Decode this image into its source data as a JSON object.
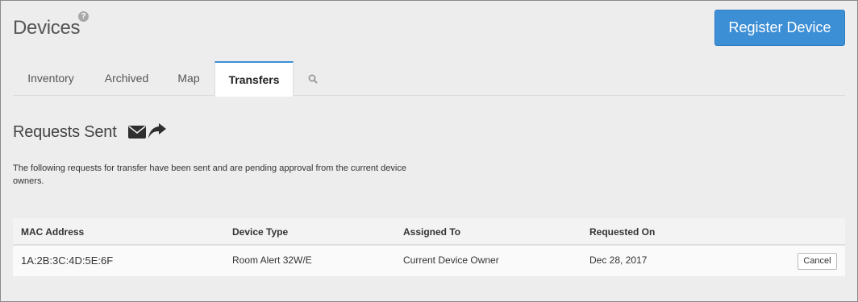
{
  "header": {
    "title": "Devices",
    "help_glyph": "?",
    "register_label": "Register Device"
  },
  "tabs": [
    {
      "label": "Inventory",
      "active": false
    },
    {
      "label": "Archived",
      "active": false
    },
    {
      "label": "Map",
      "active": false
    },
    {
      "label": "Transfers",
      "active": true
    }
  ],
  "section": {
    "title": "Requests Sent",
    "icons": [
      "envelope-icon",
      "share-icon"
    ],
    "description": "The following requests for transfer have been sent and are pending approval from the current device owners."
  },
  "table": {
    "headers": [
      "MAC Address",
      "Device Type",
      "Assigned To",
      "Requested On"
    ],
    "rows": [
      {
        "mac": "1A:2B:3C:4D:5E:6F",
        "device_type": "Room Alert 32W/E",
        "assigned_to": "Current Device Owner",
        "requested_on": "Dec 28, 2017",
        "action_label": "Cancel"
      }
    ]
  },
  "colors": {
    "accent": "#3d8fd5",
    "background": "#ededed"
  }
}
